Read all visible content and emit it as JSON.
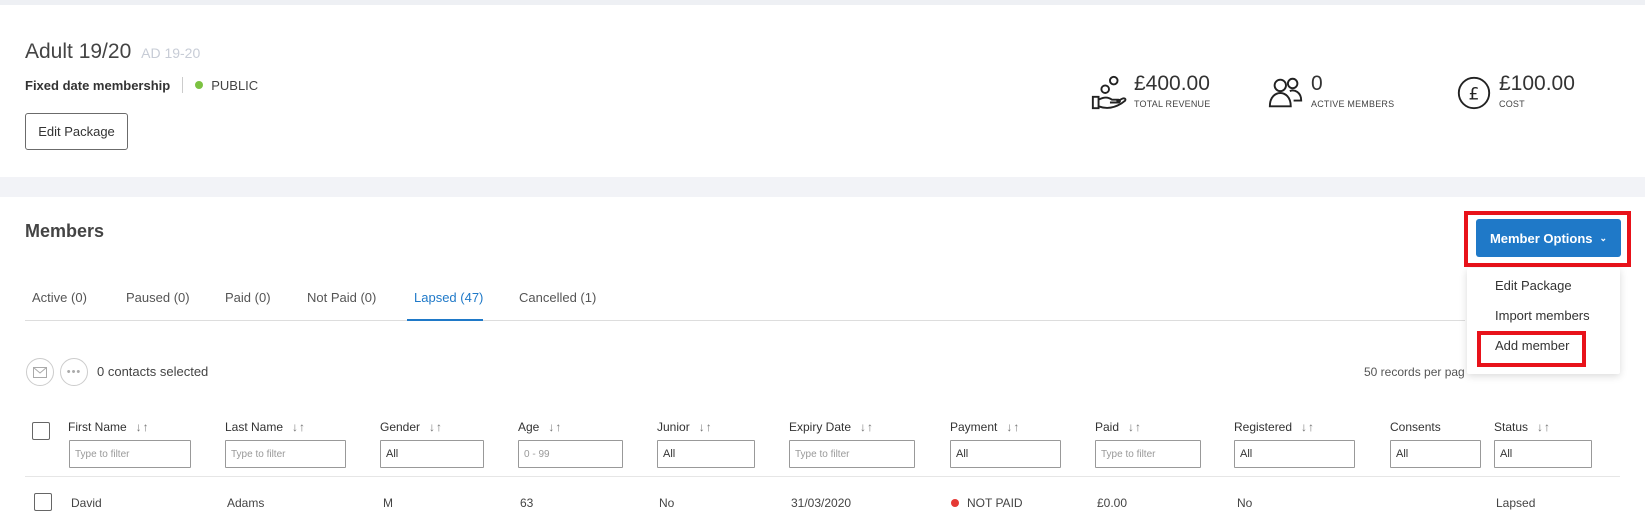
{
  "package": {
    "title": "Adult 19/20",
    "code": "AD 19-20",
    "type": "Fixed date membership",
    "visibility": "PUBLIC",
    "edit_label": "Edit Package"
  },
  "stats": [
    {
      "icon": "money-hand-icon",
      "value": "£400.00",
      "label": "TOTAL REVENUE"
    },
    {
      "icon": "users-icon",
      "value": "0",
      "label": "ACTIVE MEMBERS"
    },
    {
      "icon": "pound-icon",
      "value": "£100.00",
      "label": "COST"
    }
  ],
  "members": {
    "title": "Members",
    "options_label": "Member Options",
    "dropdown": [
      "Edit Package",
      "Import members",
      "Add member"
    ],
    "tabs": [
      "Active (0)",
      "Paused (0)",
      "Paid (0)",
      "Not Paid (0)",
      "Lapsed (47)",
      "Cancelled (1)"
    ],
    "active_tab": "Lapsed (47)",
    "contacts_selected": "0 contacts selected",
    "records_per_page": "50 records per pag",
    "columns": [
      {
        "label": "First Name",
        "filter": "input",
        "placeholder": "Type to filter"
      },
      {
        "label": "Last Name",
        "filter": "input",
        "placeholder": "Type to filter"
      },
      {
        "label": "Gender",
        "filter": "select",
        "value": "All"
      },
      {
        "label": "Age",
        "filter": "input",
        "placeholder": "0 - 99"
      },
      {
        "label": "Junior",
        "filter": "select",
        "value": "All"
      },
      {
        "label": "Expiry Date",
        "filter": "input",
        "placeholder": "Type to filter"
      },
      {
        "label": "Payment",
        "filter": "select",
        "value": "All"
      },
      {
        "label": "Paid",
        "filter": "input",
        "placeholder": "Type to filter"
      },
      {
        "label": "Registered",
        "filter": "select",
        "value": "All"
      },
      {
        "label": "Consents",
        "filter": "select",
        "value": "All"
      },
      {
        "label": "Status",
        "filter": "select",
        "value": "All"
      }
    ],
    "rows": [
      {
        "first_name": "David",
        "last_name": "Adams",
        "gender": "M",
        "age": "63",
        "junior": "No",
        "expiry": "31/03/2020",
        "payment": "NOT PAID",
        "paid": "£0.00",
        "registered": "No",
        "consents": "",
        "status": "Lapsed"
      }
    ]
  },
  "colors": {
    "accent": "#1f79c8",
    "highlight": "#e8121a",
    "public_dot": "#7cc242",
    "unpaid_dot": "#e53935"
  }
}
